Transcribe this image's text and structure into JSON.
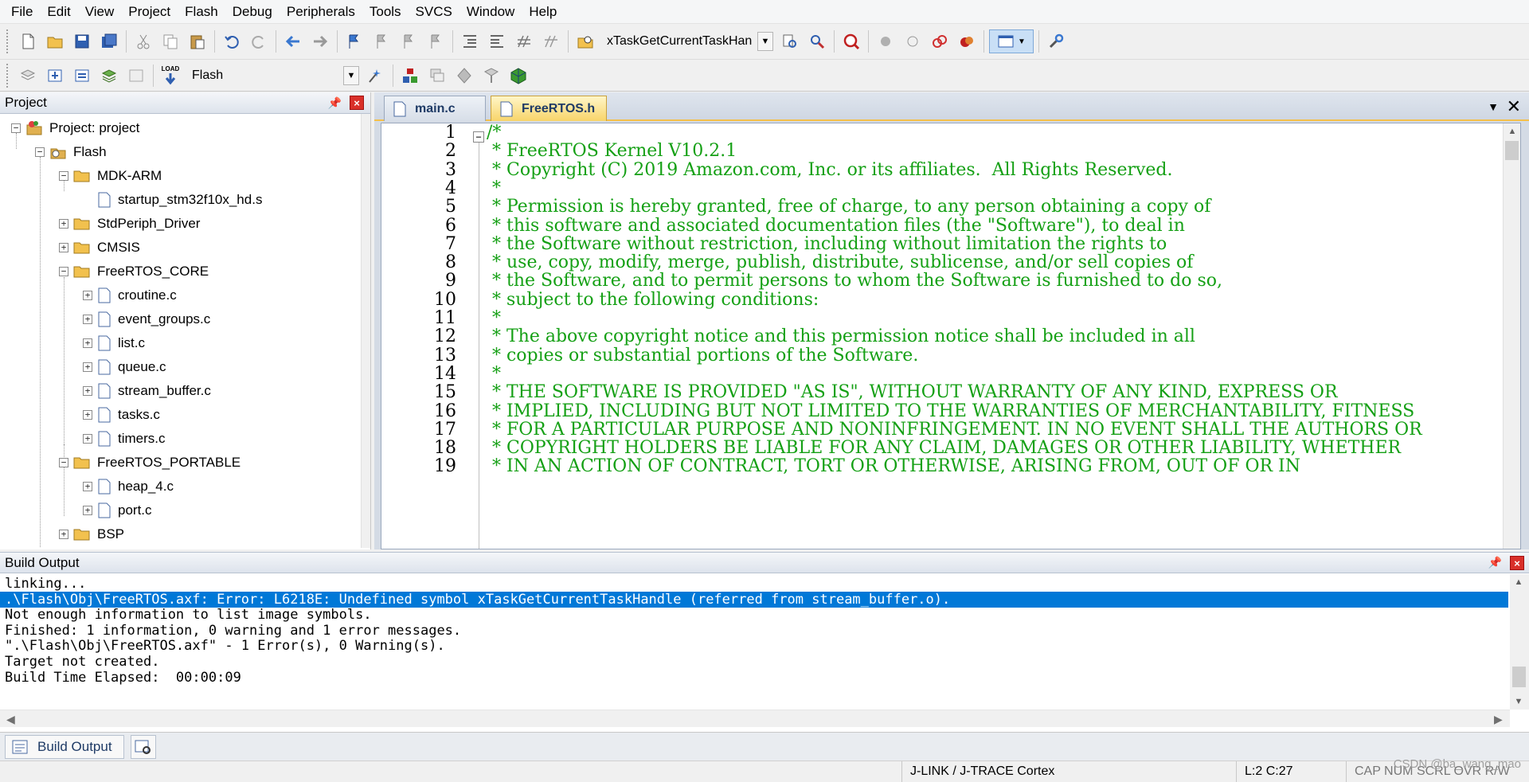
{
  "menubar": {
    "items": [
      "File",
      "Edit",
      "View",
      "Project",
      "Flash",
      "Debug",
      "Peripherals",
      "Tools",
      "SVCS",
      "Window",
      "Help"
    ]
  },
  "toolbar": {
    "find_combo_value": "xTaskGetCurrentTaskHan",
    "target_combo_value": "Flash",
    "load_label": "LOAD"
  },
  "project": {
    "title": "Project",
    "root_label": "Project: project",
    "target_label": "Flash",
    "nodes": [
      {
        "label": "MDK-ARM"
      },
      {
        "label": "startup_stm32f10x_hd.s"
      },
      {
        "label": "StdPeriph_Driver"
      },
      {
        "label": "CMSIS"
      },
      {
        "label": "FreeRTOS_CORE"
      },
      {
        "label": "croutine.c"
      },
      {
        "label": "event_groups.c"
      },
      {
        "label": "list.c"
      },
      {
        "label": "queue.c"
      },
      {
        "label": "stream_buffer.c"
      },
      {
        "label": "tasks.c"
      },
      {
        "label": "timers.c"
      },
      {
        "label": "FreeRTOS_PORTABLE"
      },
      {
        "label": "heap_4.c"
      },
      {
        "label": "port.c"
      },
      {
        "label": "BSP"
      }
    ]
  },
  "editor": {
    "tabs": [
      {
        "label": "main.c",
        "active": false
      },
      {
        "label": "FreeRTOS.h",
        "active": true
      }
    ],
    "line_numbers": [
      "1",
      "2",
      "3",
      "4",
      "5",
      "6",
      "7",
      "8",
      "9",
      "10",
      "11",
      "12",
      "13",
      "14",
      "15",
      "16",
      "17",
      "18",
      "19"
    ],
    "lines": [
      "/*",
      " * FreeRTOS Kernel V10.2.1",
      " * Copyright (C) 2019 Amazon.com, Inc. or its affiliates.  All Rights Reserved.",
      " *",
      " * Permission is hereby granted, free of charge, to any person obtaining a copy of",
      " * this software and associated documentation files (the \"Software\"), to deal in",
      " * the Software without restriction, including without limitation the rights to",
      " * use, copy, modify, merge, publish, distribute, sublicense, and/or sell copies of",
      " * the Software, and to permit persons to whom the Software is furnished to do so,",
      " * subject to the following conditions:",
      " *",
      " * The above copyright notice and this permission notice shall be included in all",
      " * copies or substantial portions of the Software.",
      " *",
      " * THE SOFTWARE IS PROVIDED \"AS IS\", WITHOUT WARRANTY OF ANY KIND, EXPRESS OR",
      " * IMPLIED, INCLUDING BUT NOT LIMITED TO THE WARRANTIES OF MERCHANTABILITY, FITNESS",
      " * FOR A PARTICULAR PURPOSE AND NONINFRINGEMENT. IN NO EVENT SHALL THE AUTHORS OR",
      " * COPYRIGHT HOLDERS BE LIABLE FOR ANY CLAIM, DAMAGES OR OTHER LIABILITY, WHETHER",
      " * IN AN ACTION OF CONTRACT, TORT OR OTHERWISE, ARISING FROM, OUT OF OR IN"
    ],
    "comment_color": "#15a015"
  },
  "build_output": {
    "title": "Build Output",
    "lines": [
      "linking...",
      ".\\Flash\\Obj\\FreeRTOS.axf: Error: L6218E: Undefined symbol xTaskGetCurrentTaskHandle (referred from stream_buffer.o).",
      "Not enough information to list image symbols.",
      "Finished: 1 information, 0 warning and 1 error messages.",
      "\".\\Flash\\Obj\\FreeRTOS.axf\" - 1 Error(s), 0 Warning(s).",
      "Target not created.",
      "Build Time Elapsed:  00:00:09"
    ],
    "selected_line": 1,
    "selection_color": "#0078d7"
  },
  "bottom_tabs": {
    "build_output_label": "Build Output"
  },
  "statusbar": {
    "debugger": "J-LINK / J-TRACE Cortex",
    "position": "L:2 C:27",
    "indicators": "CAP  NUM  SCRL  OVR  R/W",
    "watermark": "CSDN @ba_wang_mao"
  }
}
